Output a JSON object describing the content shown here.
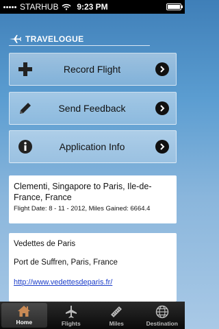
{
  "status": {
    "carrier": "STARHUB",
    "time": "9:23 PM"
  },
  "brand": {
    "title": "TRAVELOGUE"
  },
  "menu": [
    {
      "label": "Record Flight",
      "icon": "plus-icon"
    },
    {
      "label": "Send Feedback",
      "icon": "pencil-icon"
    },
    {
      "label": "Application Info",
      "icon": "info-icon"
    }
  ],
  "flight": {
    "route": "Clementi, Singapore to Paris, Ile-de-France, France",
    "meta": "Flight Date: 8 - 11 - 2012, Miles Gained: 6664.4"
  },
  "place": {
    "name": "Vedettes de Paris",
    "address": "Port de Suffren, Paris, France",
    "url": "http://www.vedettesdeparis.fr/"
  },
  "tabs": [
    {
      "label": "Home",
      "icon": "house-icon",
      "active": true
    },
    {
      "label": "Flights",
      "icon": "airplane-icon"
    },
    {
      "label": "Miles",
      "icon": "ruler-icon"
    },
    {
      "label": "Destination",
      "icon": "globe-icon"
    }
  ],
  "colors": {
    "accent": "#5b9dd1",
    "link": "#1a3cc8",
    "tabbar": "#111111"
  }
}
